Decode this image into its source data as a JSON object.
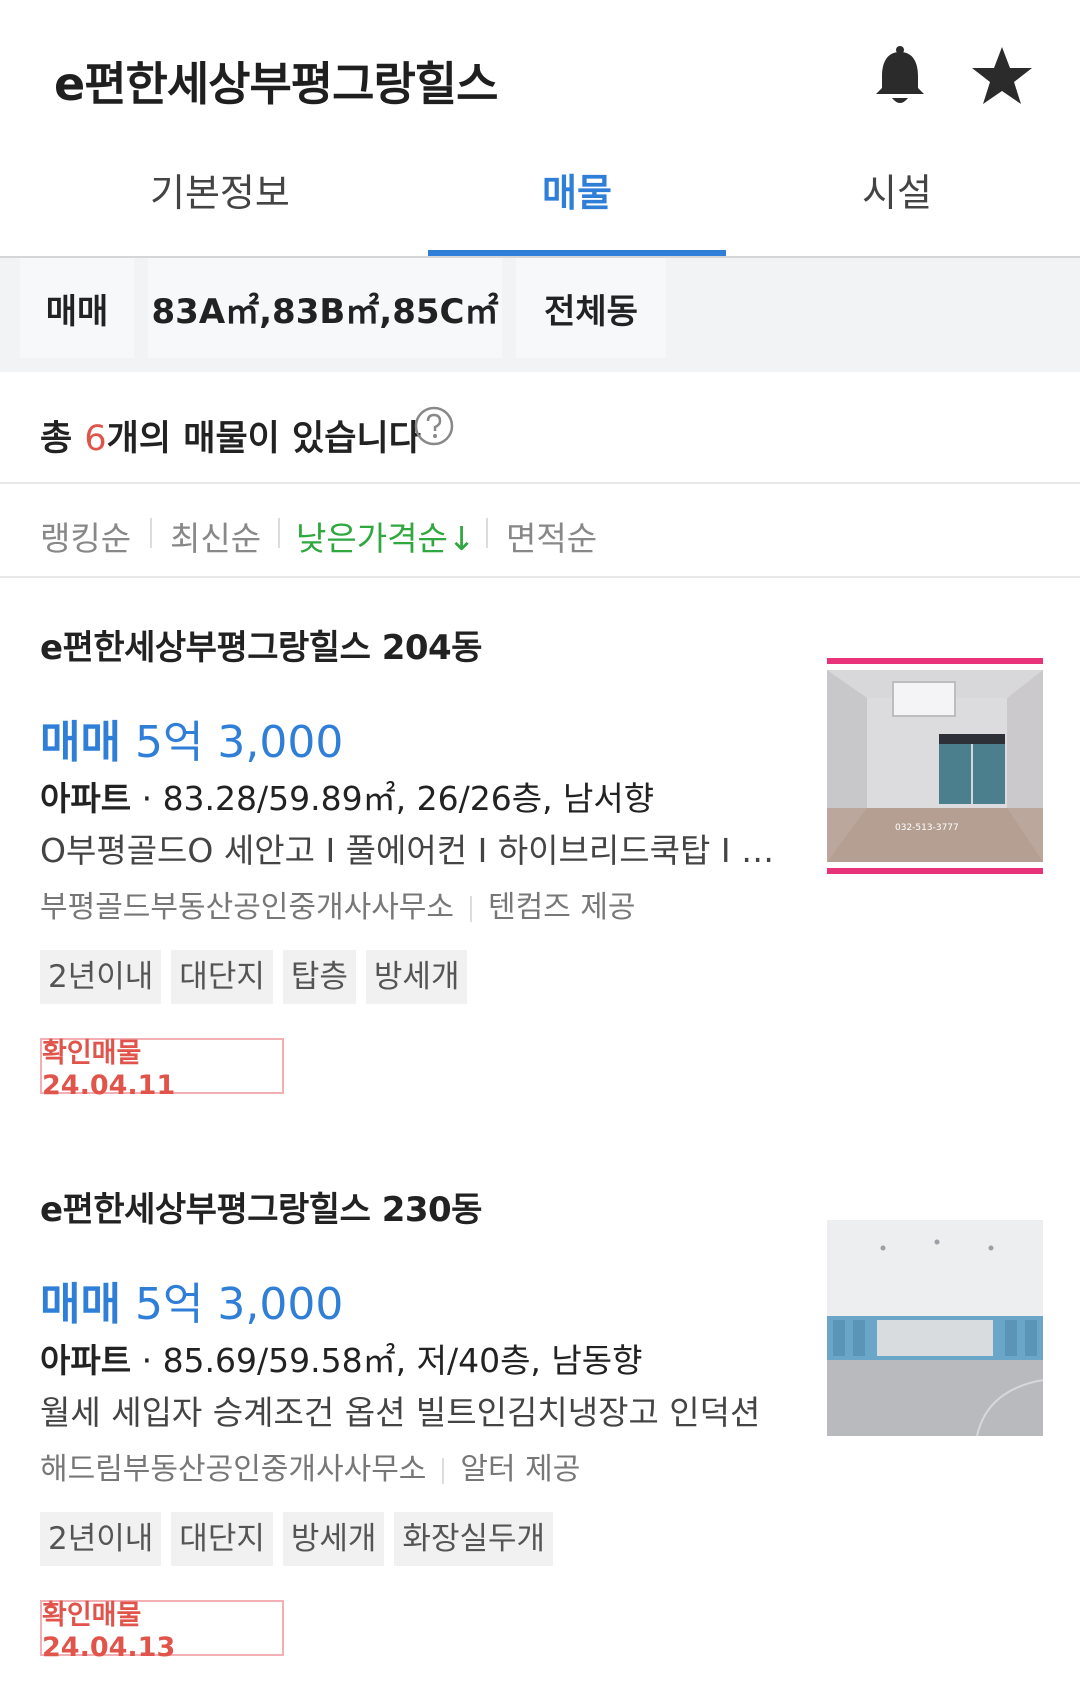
{
  "header": {
    "title": "e편한세상부평그랑힐스"
  },
  "tabs": [
    {
      "label": "기본정보"
    },
    {
      "label": "매물"
    },
    {
      "label": "시설"
    }
  ],
  "filters": {
    "deal_type": "매매",
    "area": "83A㎡,83B㎡,85C㎡",
    "building": "전체동"
  },
  "summary": {
    "prefix": "총 ",
    "count": "6",
    "suffix": "개의 매물이 있습니다"
  },
  "sort": [
    {
      "label": "랭킹순"
    },
    {
      "label": "최신순"
    },
    {
      "label": "낮은가격순↓"
    },
    {
      "label": "면적순"
    }
  ],
  "listings": [
    {
      "title": "e편한세상부평그랑힐스 204동",
      "deal": "매매",
      "price": "5억 3,000",
      "ptype": "아파트",
      "spec": " · 83.28/59.89㎡, 26/26층, 남서향",
      "desc": "O부평골드O 세안고 I 풀에어컨 I 하이브리드쿡탑 I 초...",
      "agent": "부평골드부동산공인중개사사무소",
      "provider": "텐컴즈 제공",
      "tags": [
        "2년이내",
        "대단지",
        "탑층",
        "방세개"
      ],
      "verified": "확인매물 24.04.11",
      "photo_text": "032-513-3777"
    },
    {
      "title": "e편한세상부평그랑힐스 230동",
      "deal": "매매",
      "price": "5억 3,000",
      "ptype": "아파트",
      "spec": " · 85.69/59.58㎡, 저/40층, 남동향",
      "desc": "월세 세입자 승계조건 옵션 빌트인김치냉장고 인덕션",
      "agent": "해드림부동산공인중개사사무소",
      "provider": "알터 제공",
      "tags": [
        "2년이내",
        "대단지",
        "방세개",
        "화장실두개"
      ],
      "verified": "확인매물 24.04.13"
    }
  ]
}
